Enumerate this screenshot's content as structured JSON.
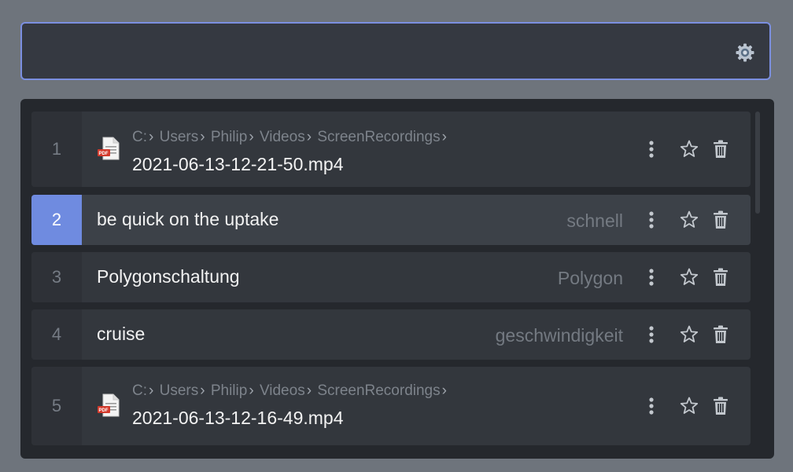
{
  "search": {
    "placeholder": "",
    "value": ""
  },
  "results": [
    {
      "index": "1",
      "type": "file",
      "path": [
        "C:",
        "Users",
        "Philip",
        "Videos",
        "ScreenRecordings"
      ],
      "filename": "2021-06-13-12-21-50.mp4",
      "hint": ""
    },
    {
      "index": "2",
      "type": "text",
      "title": "be quick on the uptake",
      "hint": "schnell",
      "selected": true
    },
    {
      "index": "3",
      "type": "text",
      "title": "Polygonschaltung",
      "hint": "Polygon"
    },
    {
      "index": "4",
      "type": "text",
      "title": "cruise",
      "hint": "geschwindigkeit"
    },
    {
      "index": "5",
      "type": "file",
      "path": [
        "C:",
        "Users",
        "Philip",
        "Videos",
        "ScreenRecordings"
      ],
      "filename": "2021-06-13-12-16-49.mp4",
      "hint": ""
    }
  ],
  "icons": {
    "settings": "gear-icon",
    "file": "pdf-file-icon",
    "more": "more-vertical-icon",
    "favorite": "star-icon",
    "delete": "trash-icon"
  },
  "colors": {
    "accent": "#6f8be0",
    "search_border": "#7b8fe0",
    "background": "#6e747c",
    "panel": "#25282d",
    "row": "#33373d"
  }
}
